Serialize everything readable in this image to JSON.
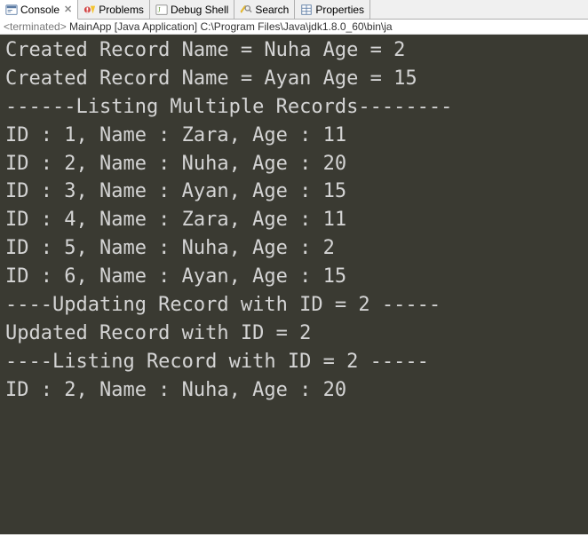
{
  "tabs": [
    {
      "label": "Console"
    },
    {
      "label": "Problems"
    },
    {
      "label": "Debug Shell"
    },
    {
      "label": "Search"
    },
    {
      "label": "Properties"
    }
  ],
  "status": {
    "prefix": "<terminated>",
    "rest": " MainApp [Java Application] C:\\Program Files\\Java\\jdk1.8.0_60\\bin\\ja"
  },
  "console_lines": [
    "Created Record Name = Nuha Age = 2",
    "Created Record Name = Ayan Age = 15",
    "------Listing Multiple Records--------",
    "ID : 1, Name : Zara, Age : 11",
    "ID : 2, Name : Nuha, Age : 20",
    "ID : 3, Name : Ayan, Age : 15",
    "ID : 4, Name : Zara, Age : 11",
    "ID : 5, Name : Nuha, Age : 2",
    "ID : 6, Name : Ayan, Age : 15",
    "----Updating Record with ID = 2 -----",
    "Updated Record with ID = 2",
    "----Listing Record with ID = 2 -----",
    "ID : 2, Name : Nuha, Age : 20"
  ]
}
